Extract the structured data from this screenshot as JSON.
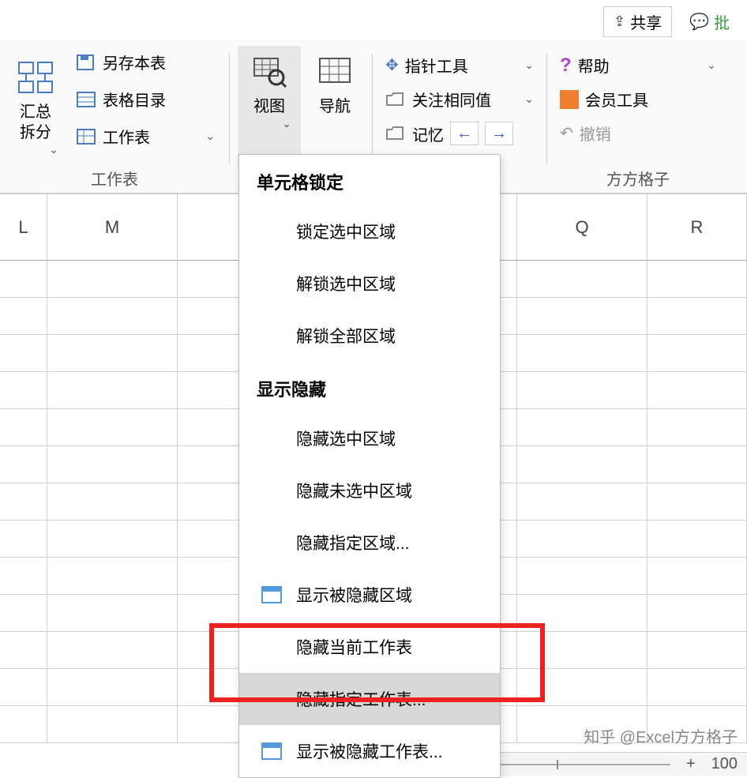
{
  "topButtons": {
    "share": "共享",
    "comment": "批"
  },
  "ribbon": {
    "group1": {
      "label": "工作表",
      "bigBtn": "汇总拆分",
      "saveAs": "另存本表",
      "tableDir": "表格目录",
      "worksheet": "工作表"
    },
    "group2": {
      "view": "视图",
      "nav": "导航"
    },
    "group3": {
      "pointer": "指针工具",
      "sameValue": "关注相同值",
      "memory": "记忆"
    },
    "group4": {
      "label": "方方格子",
      "help": "帮助",
      "member": "会员工具",
      "undo": "撤销"
    }
  },
  "columns": {
    "L": "L",
    "M": "M",
    "Q": "Q",
    "R": "R"
  },
  "menu": {
    "section1": "单元格锁定",
    "lockSel": "锁定选中区域",
    "unlockSel": "解锁选中区域",
    "unlockAll": "解锁全部区域",
    "section2": "显示隐藏",
    "hideSel": "隐藏选中区域",
    "hideUnsel": "隐藏未选中区域",
    "hideSpec": "隐藏指定区域...",
    "showHidden": "显示被隐藏区域",
    "hideCurSheet": "隐藏当前工作表",
    "hideSpecSheet": "隐藏指定工作表...",
    "showHiddenSheet": "显示被隐藏工作表..."
  },
  "watermark": "知乎 @Excel方方格子",
  "zoom": "100"
}
